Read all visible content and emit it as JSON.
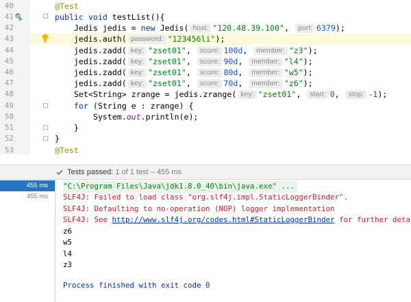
{
  "editor": {
    "line_numbers": [
      "40",
      "41",
      "42",
      "43",
      "44",
      "45",
      "46",
      "47",
      "48",
      "49",
      "50",
      "51",
      "52",
      "53"
    ],
    "lines": {
      "l40": {
        "annotation": "@Test"
      },
      "l41": {
        "kw": "public void",
        "rest": " testList(){"
      },
      "l42": {
        "pre": "    Jedis jedis = ",
        "kw": "new",
        "mid": " Jedis(",
        "hint1": "host:",
        "str1": "\"120.48.39.100\"",
        "sep": ", ",
        "hint2": "port:",
        "num": "6379",
        "end": ");"
      },
      "l43": {
        "pre": "    jedis.auth(",
        "hint": "password:",
        "str": "\"123456li\"",
        "end": ");"
      },
      "zadd": [
        {
          "pre": "    jedis.zadd(",
          "hint_key": "key:",
          "key": "\"zset01\"",
          "hint_score": "score:",
          "score": "100d",
          "hint_member": "member:",
          "member": "\"z3\"",
          "end": ");"
        },
        {
          "pre": "    jedis.zadd(",
          "hint_key": "key:",
          "key": "\"zset01\"",
          "hint_score": "score:",
          "score": "90d",
          "hint_member": "member:",
          "member": "\"l4\"",
          "end": ");"
        },
        {
          "pre": "    jedis.zadd(",
          "hint_key": "key:",
          "key": "\"zset01\"",
          "hint_score": "score:",
          "score": "80d",
          "hint_member": "member:",
          "member": "\"w5\"",
          "end": ");"
        },
        {
          "pre": "    jedis.zadd(",
          "hint_key": "key:",
          "key": "\"zset01\"",
          "hint_score": "score:",
          "score": "70d",
          "hint_member": "member:",
          "member": "\"z6\"",
          "end": ");"
        }
      ],
      "l48": {
        "pre": "    Set<String> zrange = jedis.zrange(",
        "hint_key": "key:",
        "key": "\"zset01\"",
        "hint_start": "start:",
        "start": "0",
        "hint_stop": "stop:",
        "stop": "-1",
        "end": ");"
      },
      "l49": {
        "kw": "    for",
        "rest": " (String e : zrange) {"
      },
      "l50": {
        "pre": "        System.",
        "field": "out",
        "rest": ".println(e);"
      },
      "l51": {
        "text": "    }"
      },
      "l52": {
        "text": "}"
      },
      "l53": {
        "annotation": "@Test"
      }
    }
  },
  "test_status": {
    "passed_label": "Tests passed:",
    "detail": "1 of 1 test – 455 ms"
  },
  "test_tree": [
    {
      "time": "455 ms",
      "selected": true
    },
    {
      "time": "455 ms",
      "selected": false
    }
  ],
  "console": {
    "command": "\"C:\\Program Files\\Java\\jdk1.8.0_40\\bin\\java.exe\" ...",
    "err1": "SLF4J: Failed to load class \"org.slf4j.impl.StaticLoggerBinder\".",
    "err2": "SLF4J: Defaulting to no-operation (NOP) logger implementation",
    "err3_pre": "SLF4J: See ",
    "err3_link": "http://www.slf4j.org/codes.html#StaticLoggerBinder",
    "err3_post": " for further details.",
    "output": [
      "z6",
      "w5",
      "l4",
      "z3"
    ],
    "exit": "Process finished with exit code 0"
  },
  "colors": {
    "keyword": "#0033b3",
    "string": "#067d17",
    "number": "#1750eb",
    "annotation": "#9e880d",
    "error_text": "#c4212b",
    "selection": "#2675bf",
    "line_highlight": "#fcfad9"
  },
  "icons": [
    "run-test-icon",
    "intention-bulb-icon",
    "fold-marker-icon",
    "test-passed-check-icon"
  ]
}
